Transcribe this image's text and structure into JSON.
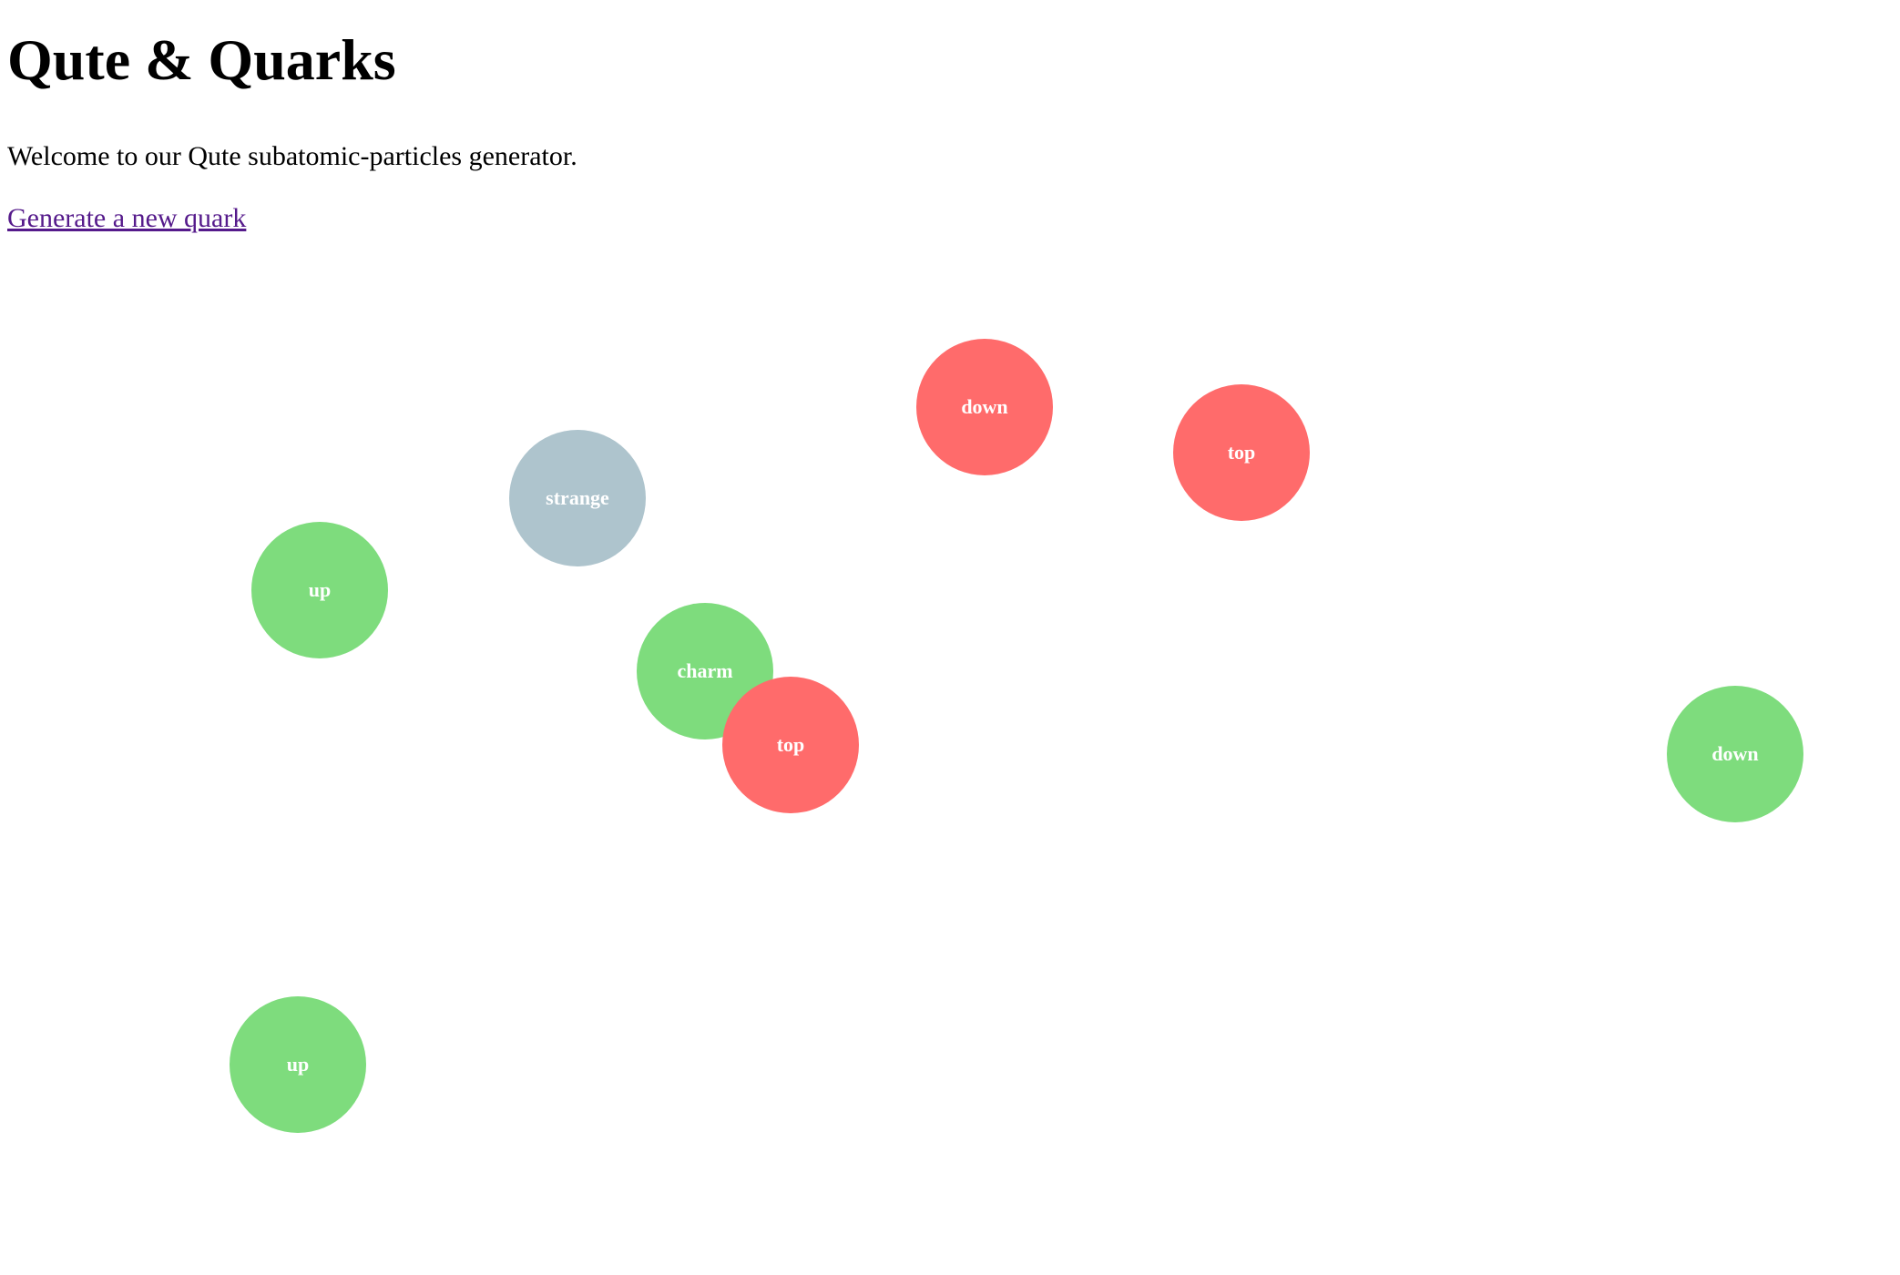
{
  "header": {
    "title": "Qute & Quarks",
    "intro": "Welcome to our Qute subatomic-particles generator.",
    "generate_link": "Generate a new quark"
  },
  "colors": {
    "link": "#551a8b",
    "quark_red": "#ff6b6b",
    "quark_green": "#7edc7d",
    "quark_gray": "#aec4cd",
    "quark_text": "#ffffff"
  },
  "quarks": [
    {
      "label": "down",
      "color": "#ff6b6b"
    },
    {
      "label": "top",
      "color": "#ff6b6b"
    },
    {
      "label": "strange",
      "color": "#aec4cd"
    },
    {
      "label": "up",
      "color": "#7edc7d"
    },
    {
      "label": "charm",
      "color": "#7edc7d"
    },
    {
      "label": "top",
      "color": "#ff6b6b"
    },
    {
      "label": "down",
      "color": "#7edc7d"
    },
    {
      "label": "up",
      "color": "#7edc7d"
    }
  ]
}
